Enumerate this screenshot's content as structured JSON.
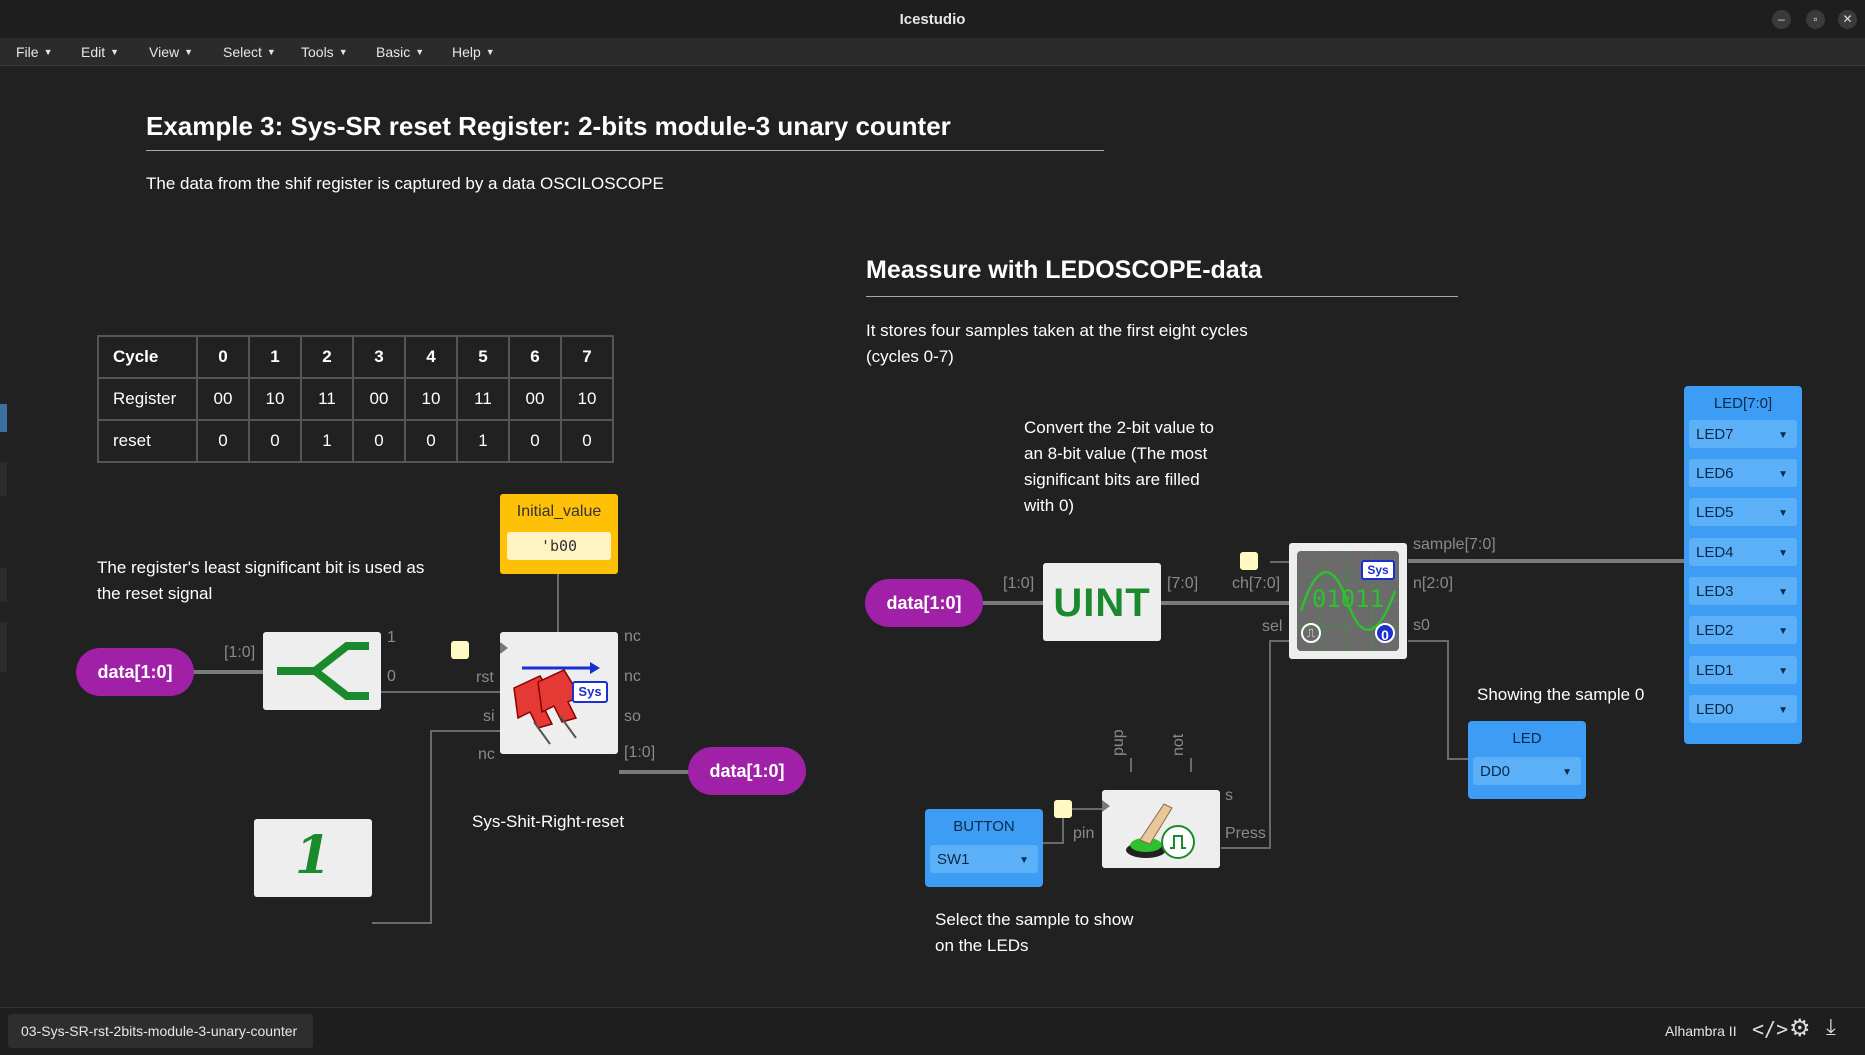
{
  "window": {
    "title": "Icestudio",
    "minimize": "–",
    "restore": "▫",
    "close": "✕"
  },
  "menu": [
    "File",
    "Edit",
    "View",
    "Select",
    "Tools",
    "Basic",
    "Help"
  ],
  "heading1": "Example 3: Sys-SR reset Register: 2-bits module-3 unary counter",
  "intro": "The data from the shif register is captured by a data OSCILOSCOPE",
  "table": {
    "header": [
      "Cycle",
      "0",
      "1",
      "2",
      "3",
      "4",
      "5",
      "6",
      "7"
    ],
    "rows": [
      [
        "Register",
        "00",
        "10",
        "11",
        "00",
        "10",
        "11",
        "00",
        "10"
      ],
      [
        "reset",
        "0",
        "0",
        "1",
        "0",
        "0",
        "1",
        "0",
        "0"
      ]
    ]
  },
  "note_lsb": [
    "The register's least significant bit is used as",
    "the reset signal"
  ],
  "left_circuit": {
    "input_label": "data[1:0]",
    "output_label": "data[1:0]",
    "split_bus": "[1:0]",
    "split_out1": "1",
    "split_out0": "0",
    "init_title": "Initial_value",
    "init_value": "'b00",
    "reg_ports": {
      "rst": "rst",
      "si": "si",
      "nc_in": "nc",
      "nc1": "nc",
      "nc2": "nc",
      "so": "so",
      "out": "[1:0]"
    },
    "reg_badge": "Sys",
    "reg_name": "Sys-Shit-Right-reset",
    "const_glyph": "1"
  },
  "heading2": "Meassure with LEDOSCOPE-data",
  "store_note": [
    "It stores four samples taken at the first eight cycles",
    "(cycles 0-7)"
  ],
  "convert_note": [
    "Convert the 2-bit value to",
    "an 8-bit value (The most",
    "significant bits are filled",
    "with 0)"
  ],
  "right_circuit": {
    "input_label": "data[1:0]",
    "in_bus": "[1:0]",
    "uint": "UINT",
    "out_bus": "[7:0]",
    "scope_ports": {
      "ch": "ch[7:0]",
      "sel": "sel",
      "sample": "sample[7:0]",
      "n": "n[2:0]",
      "s0": "s0"
    },
    "scope_badge": "Sys",
    "scope_digits": "01011",
    "scope_zero": "0",
    "button_title": "BUTTON",
    "button_value": "SW1",
    "btn_ports": {
      "pin": "pin",
      "pup": "pup",
      "not": "not",
      "s": "s",
      "press": "Press"
    },
    "led_title": "LED",
    "led_value": "DD0",
    "led_note": "Showing the sample 0",
    "leds_title": "LED[7:0]",
    "leds": [
      "LED7",
      "LED6",
      "LED5",
      "LED4",
      "LED3",
      "LED2",
      "LED1",
      "LED0"
    ]
  },
  "select_note": [
    "Select the sample to show",
    "on the LEDs"
  ],
  "status": {
    "tab": "03-Sys-SR-rst-2bits-module-3-unary-counter",
    "board": "Alhambra II"
  },
  "colors": {
    "pill": "#a020a8",
    "io": "#3d9df5",
    "init": "#ffc107"
  }
}
